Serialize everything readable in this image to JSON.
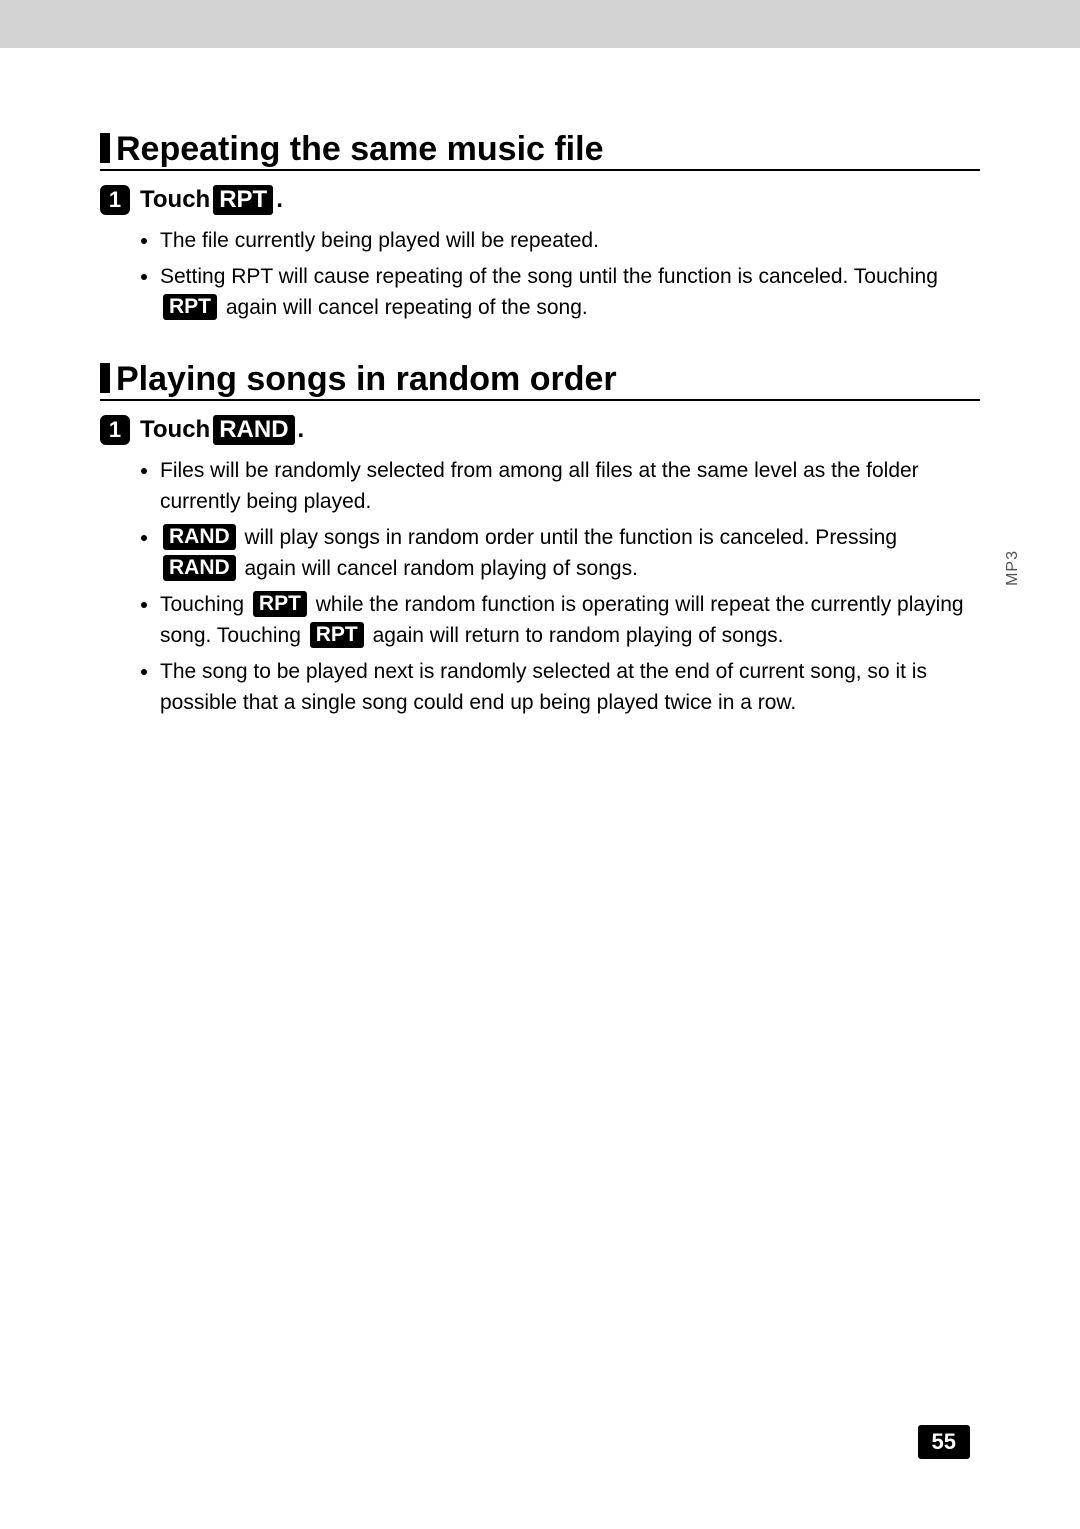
{
  "sideTab": "MP3",
  "pageNumber": "55",
  "btn": {
    "rpt": "RPT",
    "rand": "RAND"
  },
  "sec1": {
    "title": "Repeating the same music file",
    "step": {
      "num": "1",
      "pre": "Touch ",
      "post": "."
    },
    "b1": "The file currently being played will be repeated.",
    "b2a": "Setting RPT will cause repeating of the song until the function is canceled.  Touching ",
    "b2b": " again will cancel repeating of the song."
  },
  "sec2": {
    "title": "Playing songs in random order",
    "step": {
      "num": "1",
      "pre": "Touch ",
      "post": "."
    },
    "b1": "Files will be randomly selected from among all files at the same level as the folder currently being played.",
    "b2b": " will play songs in random order until the function is canceled.  Pressing ",
    "b2c": " again will cancel random playing of songs.",
    "b3a": "Touching ",
    "b3b": " while the random function is operating will repeat the currently playing song.  Touching ",
    "b3c": " again will return to random playing of songs.",
    "b4": "The song to be played next is randomly selected at the end of current song, so it is possible that a single song could end up being played twice in a row."
  }
}
